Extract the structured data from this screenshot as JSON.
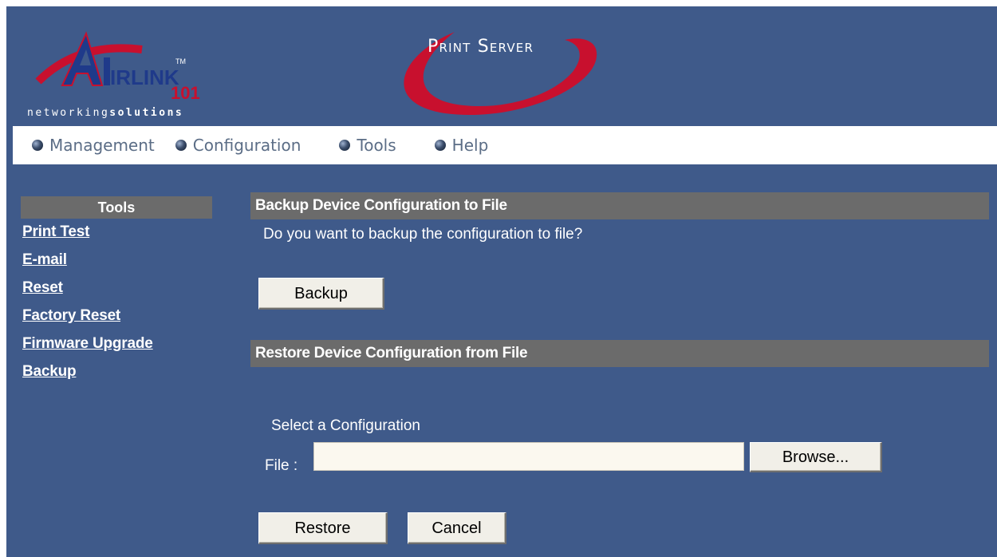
{
  "header": {
    "logo_text_regular": "networking",
    "logo_text_bold": "solutions",
    "brand_title": "Print Server"
  },
  "menu": {
    "items": [
      {
        "label": "Management"
      },
      {
        "label": "Configuration"
      },
      {
        "label": "Tools"
      },
      {
        "label": "Help"
      }
    ]
  },
  "sidebar": {
    "title": "Tools",
    "items": [
      {
        "label": "Print Test"
      },
      {
        "label": "E-mail"
      },
      {
        "label": "Reset"
      },
      {
        "label": "Factory Reset"
      },
      {
        "label": "Firmware Upgrade"
      },
      {
        "label": "Backup"
      }
    ]
  },
  "backup": {
    "header": "Backup Device Configuration to File",
    "question": "Do you want to backup the configuration to file?",
    "button_label": "Backup"
  },
  "restore": {
    "header": "Restore Device Configuration from File",
    "select_label": "Select a Configuration",
    "file_label": "File :",
    "file_value": "",
    "browse_label": "Browse...",
    "restore_label": "Restore",
    "cancel_label": "Cancel"
  },
  "colors": {
    "background": "#3f5a8a",
    "section_header": "#6b6b6b",
    "accent_red": "#c8102e"
  }
}
